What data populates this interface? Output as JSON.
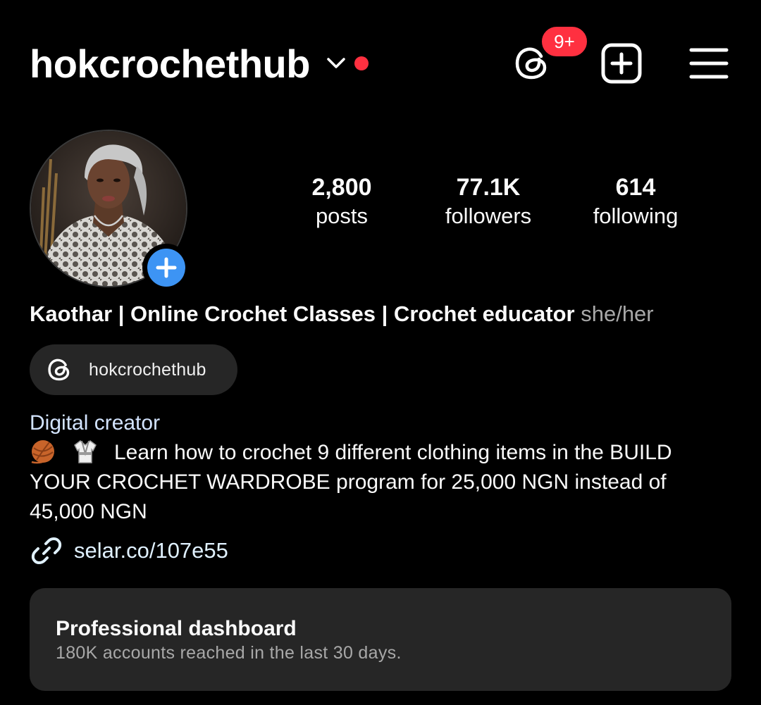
{
  "header": {
    "username": "hokcrochethub",
    "notification_count": "9+",
    "icons": [
      "chevron-down-icon",
      "threads-icon",
      "add-square-icon",
      "hamburger-menu-icon"
    ],
    "status_dot_color": "#ff3040"
  },
  "profile": {
    "stats": [
      {
        "value": "2,800",
        "label": "posts"
      },
      {
        "value": "77.1K",
        "label": "followers"
      },
      {
        "value": "614",
        "label": "following"
      }
    ],
    "full_name": "Kaothar | Online Crochet Classes | Crochet educator",
    "pronouns": "she/her",
    "threads_handle": "hokcrochethub",
    "category": "Digital creator",
    "bio_emojis": [
      "yarn-ball-icon",
      "kimono-icon"
    ],
    "bio_text": "Learn how to crochet 9 different clothing items in the BUILD YOUR CROCHET WARDROBE program for 25,000 NGN instead of 45,000 NGN",
    "link": "selar.co/107e55"
  },
  "dashboard": {
    "title": "Professional dashboard",
    "subtitle": "180K accounts reached in the last 30 days."
  },
  "colors": {
    "background": "#000000",
    "badge": "#ff3040",
    "avatar_add": "#3d94f4",
    "card": "#262626",
    "link": "#e0f1ff"
  }
}
